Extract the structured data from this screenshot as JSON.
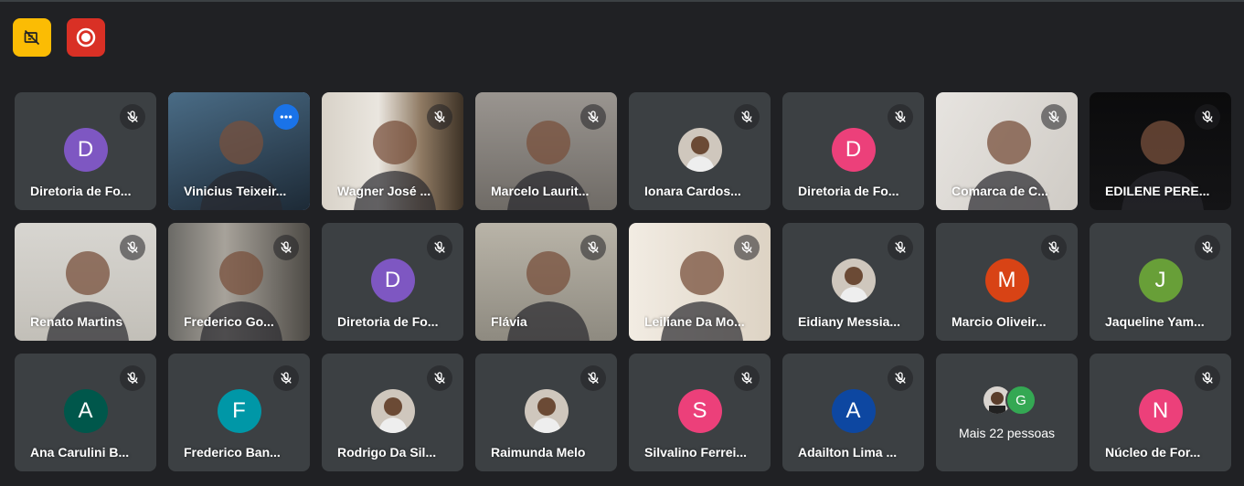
{
  "colors": {
    "background": "#202124",
    "tile": "#3c4043",
    "active_outline": "#8ab4f8",
    "record_button": "#d93025",
    "captions_button": "#fbbc04"
  },
  "top_buttons": [
    {
      "icon": "no-video-presenting-icon"
    },
    {
      "icon": "recording-icon"
    }
  ],
  "participants": [
    {
      "name": "Diretoria de Fo...",
      "initial": "D",
      "color": "#7e57c2",
      "muted": true
    },
    {
      "name": "Vinicius Teixeir...",
      "video": true,
      "active": true
    },
    {
      "name": "Wagner José ...",
      "video": true,
      "muted": true
    },
    {
      "name": "Marcelo Laurit...",
      "video": true,
      "muted": true
    },
    {
      "name": "Ionara Cardos...",
      "photo": true,
      "muted": true
    },
    {
      "name": "Diretoria de Fo...",
      "initial": "D",
      "color": "#ec407a",
      "muted": true
    },
    {
      "name": "Comarca de C...",
      "video": true,
      "muted": true
    },
    {
      "name": "EDILENE PERE...",
      "video": true,
      "muted": true
    },
    {
      "name": "Renato Martins",
      "video": true,
      "muted": true
    },
    {
      "name": "Frederico Go...",
      "video": true,
      "muted": true
    },
    {
      "name": "Diretoria de Fo...",
      "initial": "D",
      "color": "#7e57c2",
      "muted": true
    },
    {
      "name": "Flávia",
      "video": true,
      "muted": true
    },
    {
      "name": "Leiliane Da Mo...",
      "video": true,
      "muted": true
    },
    {
      "name": "Eidiany Messia...",
      "photo": true,
      "muted": true
    },
    {
      "name": "Marcio Oliveir...",
      "initial": "M",
      "color": "#d84315",
      "muted": true
    },
    {
      "name": "Jaqueline Yam...",
      "initial": "J",
      "color": "#689f38",
      "muted": true
    },
    {
      "name": "Ana Carulini B...",
      "initial": "A",
      "color": "#00574b",
      "muted": true
    },
    {
      "name": "Frederico Ban...",
      "initial": "F",
      "color": "#0097a7",
      "muted": true
    },
    {
      "name": "Rodrigo Da Sil...",
      "photo": true,
      "muted": true
    },
    {
      "name": "Raimunda Melo",
      "photo": true,
      "muted": true
    },
    {
      "name": "Silvalino Ferrei...",
      "initial": "S",
      "color": "#ec407a",
      "muted": true
    },
    {
      "name": "Adailton Lima ...",
      "initial": "A",
      "color": "#0d47a1",
      "muted": true
    },
    {
      "more": true,
      "label": "Mais 22 pessoas",
      "initial": "G"
    },
    {
      "name": "Núcleo de For...",
      "initial": "N",
      "color": "#ec407a",
      "muted": true
    }
  ]
}
